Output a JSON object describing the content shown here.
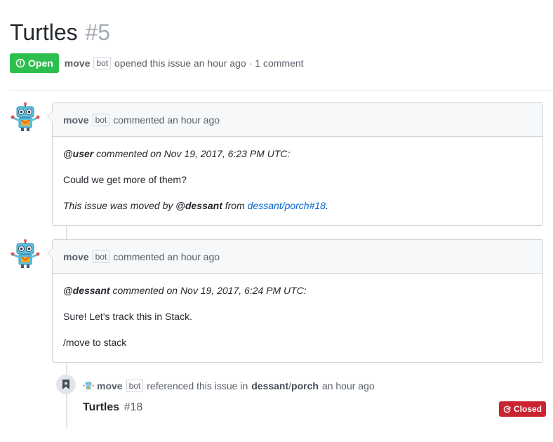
{
  "issue": {
    "title": "Turtles",
    "number": "#5",
    "state": "Open",
    "author": "move",
    "author_badge": "bot",
    "opened_text": "opened this issue an hour ago",
    "separator": "·",
    "comments_count": "1 comment"
  },
  "comments": [
    {
      "author": "move",
      "badge": "bot",
      "time_text": "commented an hour ago",
      "quote_user": "@user",
      "quote_text": "commented on Nov 19, 2017, 6:23 PM UTC:",
      "body": "Could we get more of them?",
      "moved_prefix": "This issue was moved by",
      "moved_user": "@dessant",
      "moved_from": "from",
      "moved_link": "dessant/porch#18",
      "moved_period": "."
    },
    {
      "author": "move",
      "badge": "bot",
      "time_text": "commented an hour ago",
      "quote_user": "@dessant",
      "quote_text": "commented on Nov 19, 2017, 6:24 PM UTC:",
      "body": "Sure! Let's track this in Stack.",
      "command": "/move to stack"
    }
  ],
  "reference": {
    "author": "move",
    "badge": "bot",
    "text": "referenced this issue in",
    "repo_owner": "dessant",
    "repo_sep": "/",
    "repo_name": "porch",
    "time": "an hour ago",
    "issue_title": "Turtles",
    "issue_number": "#18",
    "state": "Closed"
  },
  "colors": {
    "open": "#2cbe4e",
    "closed": "#cb2431",
    "link": "#0366d6"
  },
  "icons": {
    "open": "issue-opened-icon",
    "closed": "issue-closed-icon",
    "reference": "bookmark-icon",
    "avatar": "robot-avatar"
  }
}
